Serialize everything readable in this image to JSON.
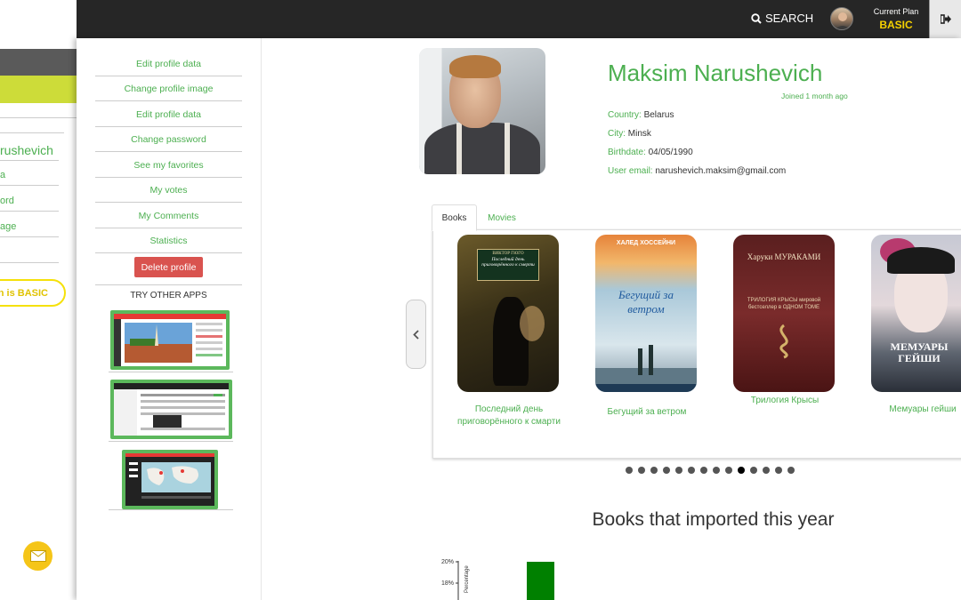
{
  "back_panel": {
    "name_fragment": "rushevich",
    "links": [
      "a",
      "ord",
      "age"
    ],
    "plan_pill": "n is BASIC"
  },
  "topbar": {
    "search_label": "SEARCH",
    "plan_label": "Current Plan",
    "plan_value": "BASIC"
  },
  "menu": {
    "items": [
      "Edit profile data",
      "Change profile image",
      "Edit profile data",
      "Change password",
      "See my favorites",
      "My votes",
      "My Comments",
      "Statistics"
    ],
    "delete_label": "Delete profile",
    "try_apps_label": "TRY OTHER APPS"
  },
  "profile": {
    "name": "Maksim Narushevich",
    "joined": "Joined 1 month ago",
    "fields": [
      {
        "label": "Country:",
        "value": "Belarus"
      },
      {
        "label": "City:",
        "value": "Minsk"
      },
      {
        "label": "Birthdate:",
        "value": "04/05/1990"
      },
      {
        "label": "User email:",
        "value": "narushevich.maksim@gmail.com"
      }
    ]
  },
  "tabs": [
    "Books",
    "Movies"
  ],
  "books": [
    {
      "title_line1": "Последний день",
      "title_line2": "приговорённого к смарти",
      "cover_author": "ВИКТОР ГЮГО",
      "cover_title": "Последний день приговорённого к смерти"
    },
    {
      "title_line1": "Бегущий за ветром",
      "title_line2": "",
      "cover_author": "ХАЛЕД ХОССЕЙНИ",
      "cover_title": "Бегущий за ветром"
    },
    {
      "title_line1": "Трилогия Крысы",
      "title_line2": "",
      "cover_author": "Харуки МУРАКАМИ",
      "cover_title": "ТРИЛОГИЯ КРЫСЫ мировой бестселлер в ОДНОМ ТОМЕ"
    },
    {
      "title_line1": "Мемуары гейши",
      "title_line2": "",
      "cover_author": "",
      "cover_title": "МЕМУАРЫ ГЕЙШИ"
    }
  ],
  "carousel_dots": {
    "count": 14,
    "active_index": 9
  },
  "chart_title": "Books that imported this year",
  "chart_data": {
    "type": "bar",
    "ylabel": "Percentage",
    "yticks": [
      "20%",
      "18%"
    ],
    "values": [
      20
    ],
    "colors": [
      "#008000"
    ]
  }
}
